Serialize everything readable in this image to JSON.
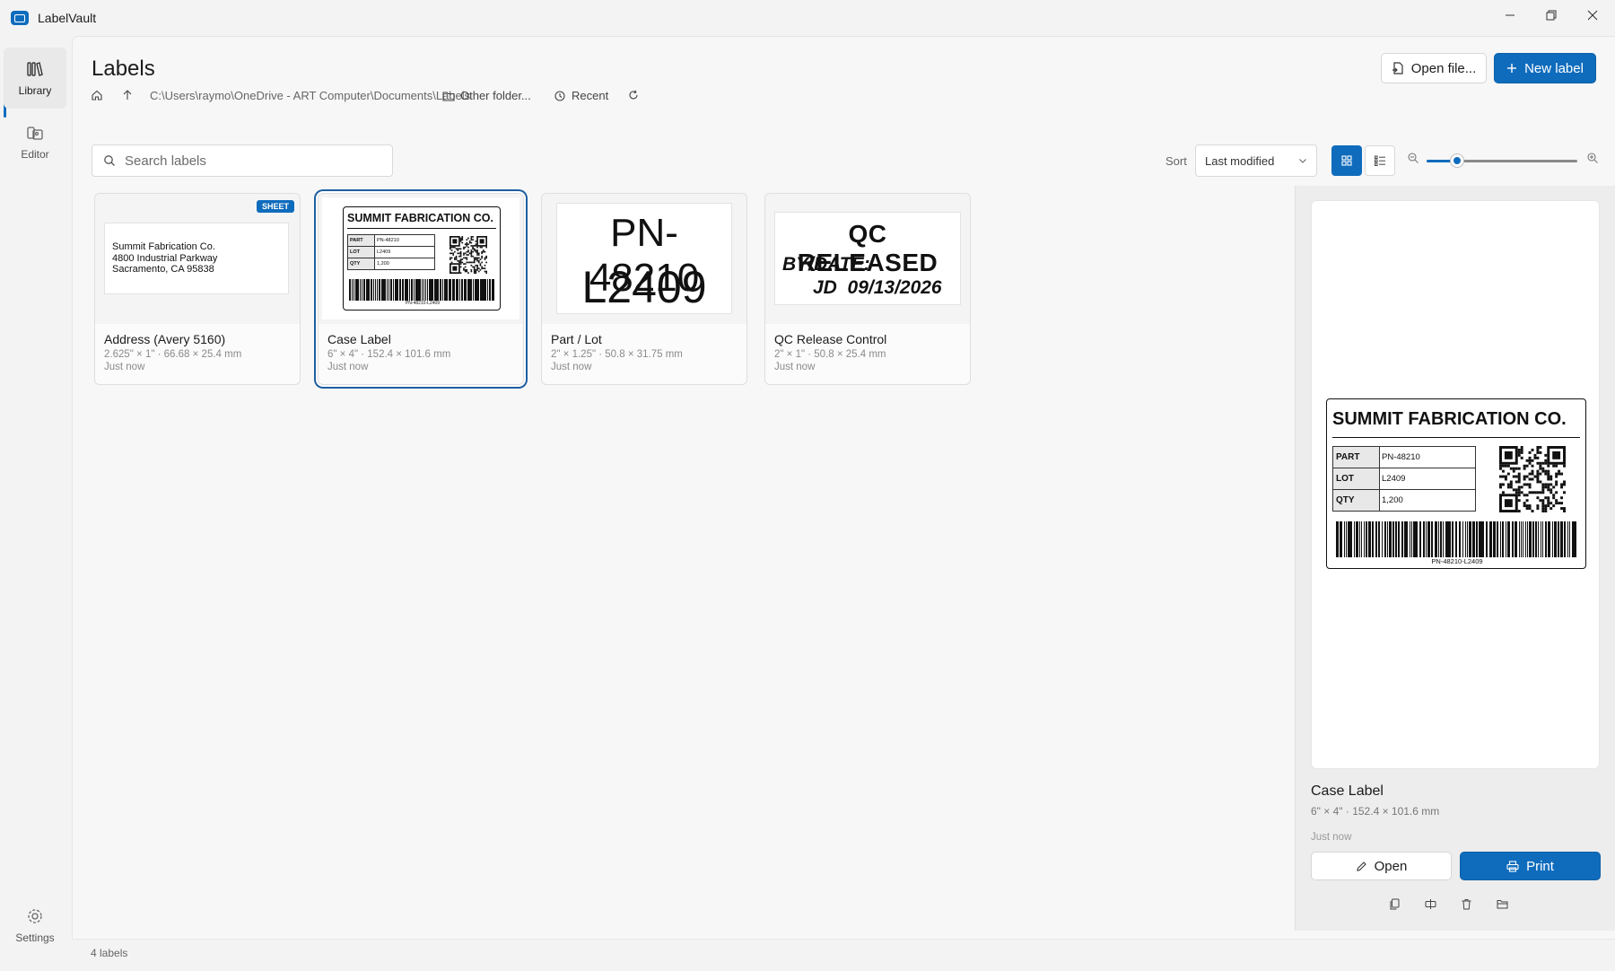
{
  "app": {
    "title": "LabelVault"
  },
  "nav": {
    "items": [
      {
        "label": "Library",
        "active": true
      },
      {
        "label": "Editor",
        "active": false
      }
    ],
    "settings_label": "Settings"
  },
  "header": {
    "title": "Labels",
    "open_file_label": "Open file...",
    "new_label_label": "New label"
  },
  "breadcrumb": {
    "path": "C:\\Users\\raymo\\OneDrive - ART Computer\\Documents\\Labels",
    "other_folder_label": "Other folder...",
    "recent_label": "Recent"
  },
  "search": {
    "placeholder": "Search labels",
    "value": ""
  },
  "toolbar": {
    "sort_label": "Sort",
    "sort_value": "Last modified",
    "zoom_level": 0.2
  },
  "cards": [
    {
      "name": "Address (Avery 5160)",
      "dims": "2.625\" × 1\"  ·  66.68 × 25.4 mm",
      "time": "Just now",
      "badge": "SHEET",
      "address_lines": [
        "Summit Fabrication Co.",
        "4800 Industrial Parkway",
        "Sacramento, CA 95838"
      ]
    },
    {
      "name": "Case Label",
      "dims": "6\" × 4\"  ·  152.4 × 101.6 mm",
      "time": "Just now"
    },
    {
      "name": "Part / Lot",
      "dims": "2\" × 1.25\"  ·  50.8 × 31.75 mm",
      "time": "Just now",
      "line1": "PN-48210",
      "line2": "L2409"
    },
    {
      "name": "QC Release Control",
      "dims": "2\" × 1\"  ·  50.8 × 25.4 mm",
      "time": "Just now",
      "line1": "QC RELEASED",
      "line2": "BY/DATE:",
      "line3": "JD  09/13/2026"
    }
  ],
  "case_label": {
    "company": "SUMMIT FABRICATION CO.",
    "rows": [
      {
        "key": "PART",
        "value": "PN-48210"
      },
      {
        "key": "LOT",
        "value": "L2409"
      },
      {
        "key": "QTY",
        "value": "1,200"
      }
    ],
    "barcode_text": "PN-48210-L2409"
  },
  "pane": {
    "name": "Case Label",
    "dims": "6\" × 4\"  ·  152.4 × 101.6 mm",
    "time": "Just now",
    "open_label": "Open",
    "print_label": "Print"
  },
  "status": {
    "count_text": "4 labels"
  },
  "colors": {
    "accent": "#0f6cbd"
  }
}
